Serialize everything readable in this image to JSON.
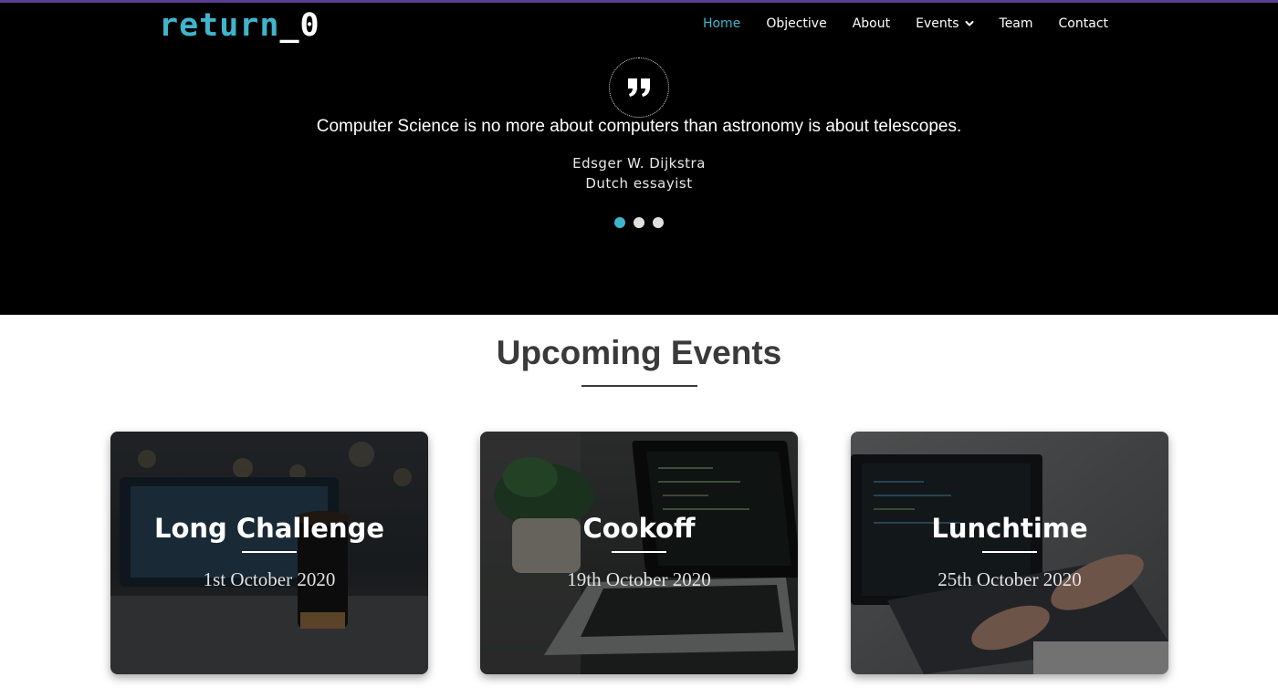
{
  "brand": {
    "logo_part_a": "return",
    "logo_part_b": "_0",
    "accent_color": "#3fb5cb"
  },
  "nav": {
    "items": [
      {
        "label": "Home",
        "active": true
      },
      {
        "label": "Objective",
        "active": false
      },
      {
        "label": "About",
        "active": false
      },
      {
        "label": "Events",
        "active": false,
        "dropdown": true
      },
      {
        "label": "Team",
        "active": false
      },
      {
        "label": "Contact",
        "active": false
      }
    ]
  },
  "hero": {
    "quote_icon": "quote-icon",
    "quote": "Computer Science is no more about computers than astronomy is about telescopes.",
    "author": "Edsger W. Dijkstra",
    "author_role": "Dutch essayist",
    "carousel_total": 3,
    "carousel_active": 1
  },
  "events_section": {
    "title": "Upcoming Events",
    "cards": [
      {
        "title": "Long Challenge",
        "date": "1st October 2020",
        "image": "laptop-coffee-cup-photo"
      },
      {
        "title": "Cookoff",
        "date": "19th October 2020",
        "image": "laptop-plant-photo"
      },
      {
        "title": "Lunchtime",
        "date": "25th October 2020",
        "image": "hands-typing-laptop-photo"
      }
    ]
  }
}
